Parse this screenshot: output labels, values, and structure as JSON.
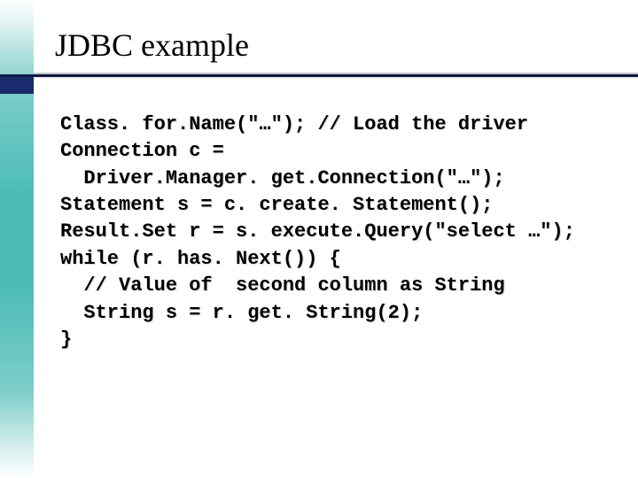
{
  "slide": {
    "title": "JDBC example",
    "code_lines": [
      "Class. for.Name(\"…\"); // Load the driver",
      "Connection c =",
      "  Driver.Manager. get.Connection(\"…\");",
      "Statement s = c. create. Statement();",
      "Result.Set r = s. execute.Query(\"select …\");",
      "while (r. has. Next()) {",
      "  // Value of  second column as String",
      "  String s = r. get. String(2);",
      "}"
    ]
  }
}
